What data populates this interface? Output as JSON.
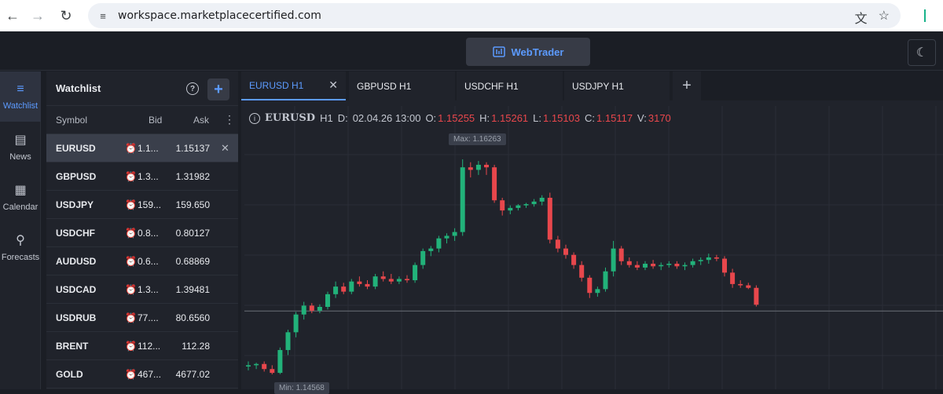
{
  "browser": {
    "url": "workspace.marketplacecertified.com",
    "back_icon": "arrow-left-icon",
    "forward_icon": "arrow-right-icon",
    "reload_icon": "reload-icon"
  },
  "appbar": {
    "webtrader_label": "WebTrader"
  },
  "leftnav": {
    "items": [
      {
        "label": "Watchlist",
        "icon": "watchlist-icon",
        "active": true
      },
      {
        "label": "News",
        "icon": "news-icon"
      },
      {
        "label": "Calendar",
        "icon": "calendar-icon"
      },
      {
        "label": "Forecasts",
        "icon": "forecasts-icon"
      }
    ]
  },
  "watchlist": {
    "title": "Watchlist",
    "columns": {
      "symbol": "Symbol",
      "bid": "Bid",
      "ask": "Ask"
    },
    "rows": [
      {
        "symbol": "EURUSD",
        "bid": "1.1...",
        "ask": "1.15137",
        "selected": true
      },
      {
        "symbol": "GBPUSD",
        "bid": "1.3...",
        "ask": "1.31982"
      },
      {
        "symbol": "USDJPY",
        "bid": "159...",
        "ask": "159.650"
      },
      {
        "symbol": "USDCHF",
        "bid": "0.8...",
        "ask": "0.80127"
      },
      {
        "symbol": "AUDUSD",
        "bid": "0.6...",
        "ask": "0.68869"
      },
      {
        "symbol": "USDCAD",
        "bid": "1.3...",
        "ask": "1.39481"
      },
      {
        "symbol": "USDRUB",
        "bid": "77....",
        "ask": "80.6560"
      },
      {
        "symbol": "BRENT",
        "bid": "112...",
        "ask": "112.28"
      },
      {
        "symbol": "GOLD",
        "bid": "467...",
        "ask": "4677.02"
      }
    ]
  },
  "tabs": [
    {
      "label": "EURUSD H1",
      "active": true
    },
    {
      "label": "GBPUSD H1"
    },
    {
      "label": "USDCHF H1"
    },
    {
      "label": "USDJPY H1"
    }
  ],
  "ohlc": {
    "symbol": "EURUSD",
    "timeframe": "H1",
    "date_label": "D:",
    "date": "02.04.26 13:00",
    "o_label": "O:",
    "o": "1.15255",
    "h_label": "H:",
    "h": "1.15261",
    "l_label": "L:",
    "l": "1.15103",
    "c_label": "C:",
    "c": "1.15117",
    "v_label": "V:",
    "v": "3170"
  },
  "chart_data": {
    "type": "candlestick",
    "symbol": "EURUSD",
    "timeframe": "H1",
    "max_label": "Max: 1.16263",
    "min_label": "Min: 1.14568",
    "max": 1.16263,
    "min": 1.14568,
    "current_price": 1.15117,
    "colors": {
      "up": "#22b27a",
      "down": "#e8474c",
      "grid": "#2a2e37",
      "bg": "#20232b"
    },
    "candles": [
      [
        1.1463,
        1.1467,
        1.146,
        1.1464
      ],
      [
        1.1464,
        1.1466,
        1.1461,
        1.1465
      ],
      [
        1.1465,
        1.1467,
        1.1459,
        1.1461
      ],
      [
        1.1461,
        1.1464,
        1.14568,
        1.1458
      ],
      [
        1.1458,
        1.1478,
        1.1457,
        1.1476
      ],
      [
        1.1476,
        1.1492,
        1.1472,
        1.149
      ],
      [
        1.149,
        1.1506,
        1.1486,
        1.1504
      ],
      [
        1.1504,
        1.1514,
        1.15,
        1.1511
      ],
      [
        1.1511,
        1.1513,
        1.1505,
        1.1507
      ],
      [
        1.1507,
        1.1512,
        1.1505,
        1.151
      ],
      [
        1.151,
        1.1522,
        1.1508,
        1.152
      ],
      [
        1.152,
        1.153,
        1.1517,
        1.1526
      ],
      [
        1.1526,
        1.1529,
        1.152,
        1.1522
      ],
      [
        1.1522,
        1.1532,
        1.152,
        1.153
      ],
      [
        1.153,
        1.1534,
        1.1526,
        1.1528
      ],
      [
        1.1528,
        1.1531,
        1.1524,
        1.1526
      ],
      [
        1.1526,
        1.1536,
        1.1524,
        1.1534
      ],
      [
        1.1534,
        1.1538,
        1.153,
        1.1532
      ],
      [
        1.1532,
        1.1536,
        1.1528,
        1.153
      ],
      [
        1.153,
        1.1534,
        1.1528,
        1.1532
      ],
      [
        1.1532,
        1.1535,
        1.1529,
        1.1531
      ],
      [
        1.1531,
        1.1545,
        1.1529,
        1.1543
      ],
      [
        1.1543,
        1.1556,
        1.154,
        1.1554
      ],
      [
        1.1554,
        1.1558,
        1.155,
        1.1556
      ],
      [
        1.1556,
        1.1566,
        1.1553,
        1.1564
      ],
      [
        1.1564,
        1.1568,
        1.156,
        1.1566
      ],
      [
        1.1566,
        1.1572,
        1.1562,
        1.1569
      ],
      [
        1.1569,
        1.16263,
        1.1566,
        1.162
      ],
      [
        1.162,
        1.1624,
        1.1612,
        1.1618
      ],
      [
        1.1618,
        1.1625,
        1.1614,
        1.1622
      ],
      [
        1.1622,
        1.1624,
        1.1614,
        1.162
      ],
      [
        1.162,
        1.1622,
        1.1592,
        1.1594
      ],
      [
        1.1594,
        1.1596,
        1.1582,
        1.1586
      ],
      [
        1.1586,
        1.159,
        1.1583,
        1.1588
      ],
      [
        1.1588,
        1.1591,
        1.1586,
        1.159
      ],
      [
        1.159,
        1.1592,
        1.1588,
        1.1591
      ],
      [
        1.1591,
        1.1595,
        1.1589,
        1.1593
      ],
      [
        1.1593,
        1.1598,
        1.159,
        1.1596
      ],
      [
        1.1596,
        1.16,
        1.156,
        1.1563
      ],
      [
        1.1563,
        1.1566,
        1.1553,
        1.1556
      ],
      [
        1.1556,
        1.1559,
        1.1548,
        1.1551
      ],
      [
        1.1551,
        1.1553,
        1.154,
        1.1543
      ],
      [
        1.1543,
        1.1546,
        1.153,
        1.1533
      ],
      [
        1.1533,
        1.1535,
        1.1517,
        1.1521
      ],
      [
        1.1521,
        1.1526,
        1.1518,
        1.1524
      ],
      [
        1.1524,
        1.1541,
        1.1522,
        1.1538
      ],
      [
        1.1538,
        1.1562,
        1.1534,
        1.1556
      ],
      [
        1.1556,
        1.1558,
        1.1543,
        1.1546
      ],
      [
        1.1546,
        1.1549,
        1.1541,
        1.1543
      ],
      [
        1.1543,
        1.1546,
        1.1539,
        1.1541
      ],
      [
        1.1541,
        1.1546,
        1.1539,
        1.1544
      ],
      [
        1.1544,
        1.1547,
        1.154,
        1.1542
      ],
      [
        1.1542,
        1.1545,
        1.1539,
        1.1543
      ],
      [
        1.1543,
        1.1546,
        1.1541,
        1.1544
      ],
      [
        1.1544,
        1.1546,
        1.154,
        1.1542
      ],
      [
        1.1542,
        1.1545,
        1.1539,
        1.1543
      ],
      [
        1.1543,
        1.1548,
        1.1541,
        1.1546
      ],
      [
        1.1546,
        1.1549,
        1.1543,
        1.1547
      ],
      [
        1.1547,
        1.1552,
        1.1544,
        1.1549
      ],
      [
        1.1549,
        1.1551,
        1.1546,
        1.1548
      ],
      [
        1.1548,
        1.155,
        1.1534,
        1.1537
      ],
      [
        1.1537,
        1.154,
        1.1525,
        1.1528
      ],
      [
        1.1528,
        1.1531,
        1.1525,
        1.1527
      ],
      [
        1.1527,
        1.1529,
        1.1524,
        1.1525
      ],
      [
        1.1525,
        1.1527,
        1.15103,
        1.15117
      ]
    ]
  }
}
